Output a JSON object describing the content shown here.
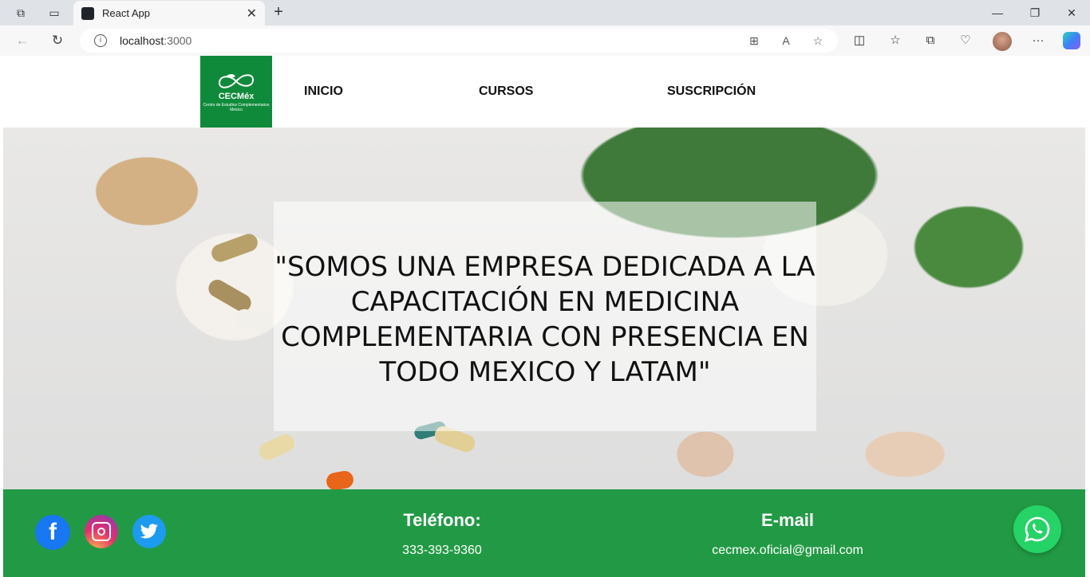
{
  "browser": {
    "tab_title": "React App",
    "url_host": "localhost",
    "url_port": ":3000"
  },
  "nav": {
    "logo_brand": "CECMéx",
    "logo_sub": "Centro de Estudios Complementarios México",
    "links": [
      "INICIO",
      "CURSOS",
      "SUSCRIPCIÓN"
    ]
  },
  "hero": {
    "quote": "\"SOMOS UNA EMPRESA DEDICADA A LA CAPACITACIÓN EN MEDICINA COMPLEMENTARIA CON PRESENCIA EN TODO MEXICO Y LATAM\""
  },
  "footer": {
    "phone_title": "Teléfono:",
    "phone_value": "333-393-9360",
    "email_title": "E-mail",
    "email_value": "cecmex.oficial@gmail.com"
  },
  "icons": {
    "facebook": "facebook-icon",
    "instagram": "instagram-icon",
    "twitter": "twitter-icon",
    "whatsapp": "whatsapp-icon"
  },
  "colors": {
    "brand_green": "#229a45",
    "logo_green": "#0f8a3a",
    "whatsapp": "#25d366"
  }
}
